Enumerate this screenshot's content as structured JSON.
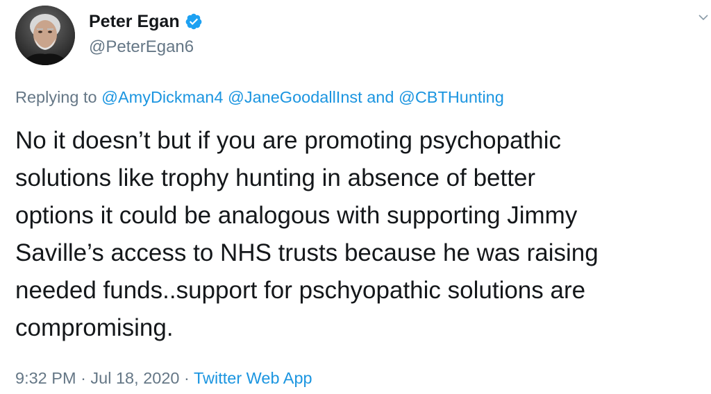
{
  "tweet": {
    "author": {
      "display_name": "Peter Egan",
      "handle": "@PeterEgan6",
      "verified": true,
      "avatar_icon": "avatar-photo"
    },
    "reply": {
      "prefix": "Replying to",
      "mention_1": "@AmyDickman4",
      "mention_2": "@JaneGoodallInst",
      "conjunction": "and",
      "mention_3": "@CBTHunting"
    },
    "text": "No it doesn’t but if you are promoting psychopathic\nsolutions like trophy hunting in absence of better\noptions it could be analogous with supporting Jimmy\nSaville’s access to NHS trusts because he was raising\nneeded funds..support for pschyopathic solutions are\ncompromising.",
    "time": "9:32 PM",
    "separator": "·",
    "date": "Jul 18, 2020",
    "source": "Twitter Web App"
  },
  "colors": {
    "text": "#14171a",
    "secondary": "#657786",
    "link": "#1b95e0",
    "verified": "#1da1f2"
  }
}
